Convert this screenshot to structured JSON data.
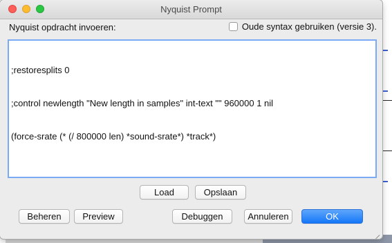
{
  "window": {
    "title": "Nyquist Prompt"
  },
  "prompt": {
    "label": "Nyquist opdracht invoeren:",
    "legacy_syntax_label": "Oude syntax gebruiken (versie 3).",
    "legacy_syntax_checked": false,
    "code_lines": [
      ";restoresplits 0",
      ";control newlength \"New length in samples\" int-text \"\" 960000 1 nil",
      "(force-srate (* (/ 800000 len) *sound-srate*) *track*)"
    ]
  },
  "buttons": {
    "load": "Load",
    "save": "Opslaan",
    "manage": "Beheren",
    "preview": "Preview",
    "debug": "Debuggen",
    "cancel": "Annuleren",
    "ok": "OK"
  },
  "colors": {
    "accent": "#1477f8",
    "editor_focus_border": "#7aaaf3",
    "close": "#fc5f57",
    "minimize": "#fdbc2e",
    "maximize": "#28c840"
  }
}
